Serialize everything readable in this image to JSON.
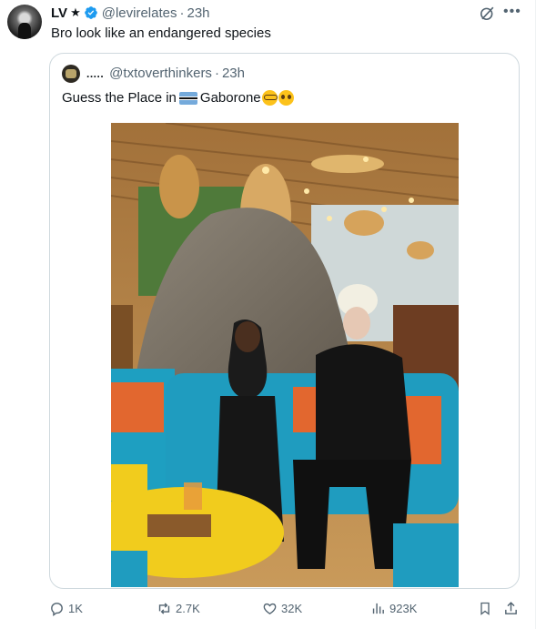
{
  "tweet": {
    "author_name": "LV",
    "author_star": "★",
    "handle": "@levirelates",
    "separator": "·",
    "time": "23h",
    "text": "Bro look like an endangered species"
  },
  "quote": {
    "author_name": ".....",
    "handle": "@txtoverthinkers",
    "separator": "·",
    "time": "23h",
    "text_before": "Guess the Place in",
    "place": "Gaborone",
    "flag_icon": "botswana-flag-icon",
    "emojis": [
      "nerd-face-icon",
      "pleading-face-icon"
    ],
    "photo_description_icon": "photo-image"
  },
  "actions": {
    "replies": "1K",
    "reposts": "2.7K",
    "likes": "32K",
    "views": "923K"
  },
  "colors": {
    "verified": "#1d9bf0",
    "text": "#0f1419",
    "muted": "#536471",
    "border": "#cfd9de"
  }
}
